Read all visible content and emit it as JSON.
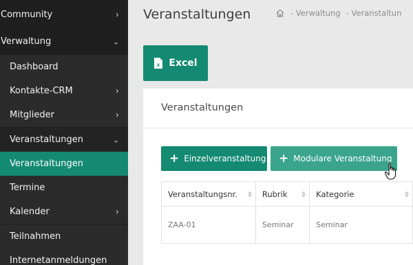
{
  "sidebar": {
    "items": [
      {
        "label": "Community",
        "chevron": "›"
      },
      {
        "label": "Verwaltung",
        "chevron": "⌄"
      },
      {
        "label": "Dashboard",
        "chevron": ""
      },
      {
        "label": "Kontakte-CRM",
        "chevron": "›"
      },
      {
        "label": "Mitglieder",
        "chevron": "›"
      },
      {
        "label": "Veranstaltungen",
        "chevron": "⌄"
      },
      {
        "label": "Veranstaltungen",
        "chevron": ""
      },
      {
        "label": "Termine",
        "chevron": ""
      },
      {
        "label": "Kalender",
        "chevron": "›"
      },
      {
        "label": "Teilnahmen",
        "chevron": ""
      },
      {
        "label": "Internetanmeldungen",
        "chevron": ""
      }
    ]
  },
  "header": {
    "title": "Veranstaltungen",
    "breadcrumb": [
      "- Verwaltung",
      "- Veranstaltun"
    ]
  },
  "toolbar": {
    "excel_label": "Excel"
  },
  "card": {
    "title": "Veranstaltungen",
    "btn_einzel": "Einzelveranstaltung",
    "btn_modular": "Modulare Veranstaltung"
  },
  "table": {
    "columns": [
      "Veranstaltungsnr.",
      "Rubrik",
      "Kategorie"
    ],
    "rows": [
      [
        "ZAA-01",
        "Seminar",
        "Seminar"
      ]
    ]
  },
  "colors": {
    "accent": "#148a72",
    "accent_light": "#3aa58c",
    "sidebar": "#1f1f1f"
  }
}
